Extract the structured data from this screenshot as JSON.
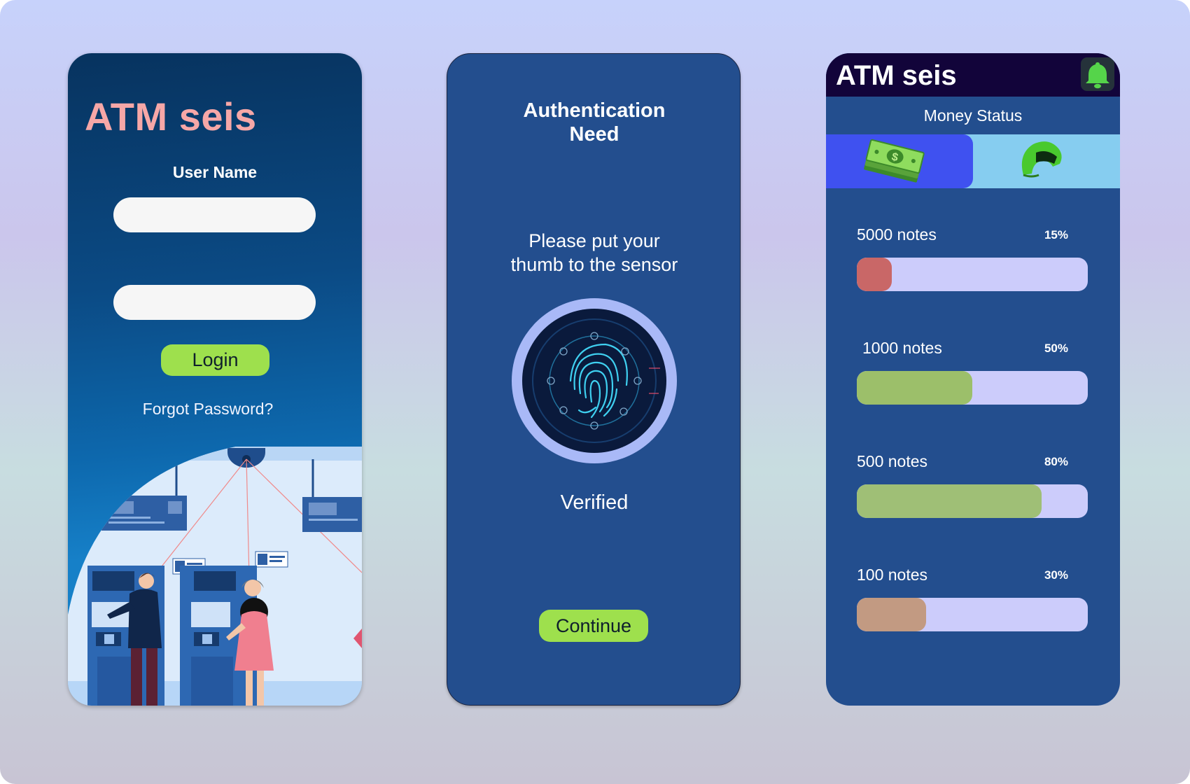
{
  "login_screen": {
    "brand": "ATM seis",
    "username_label": "User Name",
    "username_value": "",
    "password_value": "",
    "login_label": "Login",
    "forgot_label": "Forgot Password?"
  },
  "auth_screen": {
    "title_line1": "Authentication",
    "title_line2": "Need",
    "instruction_line1": "Please put your",
    "instruction_line2": "thumb to the sensor",
    "status": "Verified",
    "continue_label": "Continue"
  },
  "status_screen": {
    "brand": "ATM seis",
    "section_title": "Money Status",
    "tabs": [
      {
        "icon": "cash-stack-icon",
        "active": true
      },
      {
        "icon": "helmet-icon",
        "active": false
      }
    ],
    "notes": [
      {
        "label": "5000 notes",
        "percent_label": "15%",
        "fraction": 0.15,
        "color": "#c96767"
      },
      {
        "label": "1000 notes",
        "percent_label": "50%",
        "fraction": 0.5,
        "color": "#9cbf6a"
      },
      {
        "label": "500 notes",
        "percent_label": "80%",
        "fraction": 0.8,
        "color": "#9fbf76"
      },
      {
        "label": "100 notes",
        "percent_label": "30%",
        "fraction": 0.3,
        "color": "#c29a82"
      }
    ]
  },
  "colors": {
    "accent_green": "#9ee04d",
    "brand_pink": "#f6a7a7",
    "panel_blue": "#234e8e",
    "topbar": "#12043a"
  }
}
